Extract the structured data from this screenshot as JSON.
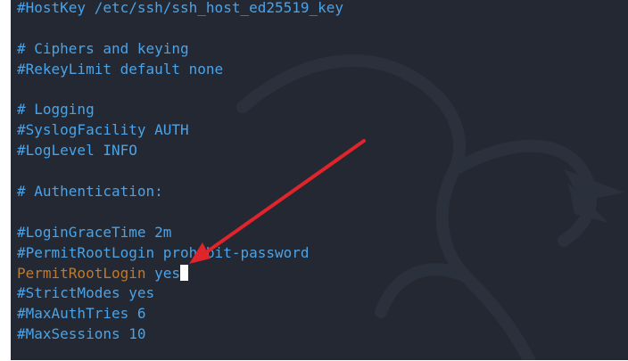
{
  "editor": {
    "lines": [
      {
        "type": "comment",
        "text": "#HostKey /etc/ssh/ssh_host_ed25519_key"
      },
      {
        "type": "blank",
        "text": ""
      },
      {
        "type": "comment",
        "text": "# Ciphers and keying"
      },
      {
        "type": "comment",
        "text": "#RekeyLimit default none"
      },
      {
        "type": "blank",
        "text": ""
      },
      {
        "type": "comment",
        "text": "# Logging"
      },
      {
        "type": "comment",
        "text": "#SyslogFacility AUTH"
      },
      {
        "type": "comment",
        "text": "#LogLevel INFO"
      },
      {
        "type": "blank",
        "text": ""
      },
      {
        "type": "comment",
        "text": "# Authentication:"
      },
      {
        "type": "blank",
        "text": ""
      },
      {
        "type": "comment",
        "text": "#LoginGraceTime 2m"
      },
      {
        "type": "comment",
        "text": "#PermitRootLogin prohibit-password"
      },
      {
        "type": "directive",
        "key": "PermitRootLogin",
        "value": "yes",
        "cursor": true
      },
      {
        "type": "comment",
        "text": "#StrictModes yes"
      },
      {
        "type": "comment",
        "text": "#MaxAuthTries 6"
      },
      {
        "type": "comment",
        "text": "#MaxSessions 10"
      }
    ]
  },
  "theme": {
    "background": "#232832",
    "comment_color": "#4aa3e8",
    "directive_color": "#c07a2b",
    "annotation_color": "#e0242b"
  },
  "annotation": {
    "icon": "red-arrow-icon"
  }
}
